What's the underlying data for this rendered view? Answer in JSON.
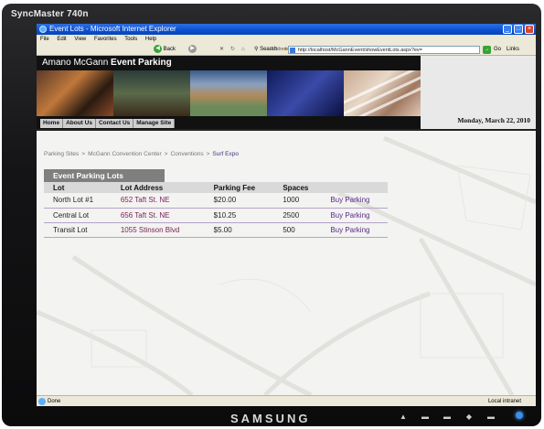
{
  "monitor": {
    "model": "SyncMaster 740n",
    "brand": "SAMSUNG"
  },
  "browser": {
    "window_title": "Event Lots - Microsoft Internet Explorer",
    "menu": [
      "File",
      "Edit",
      "View",
      "Favorites",
      "Tools",
      "Help"
    ],
    "toolbar": {
      "back_label": "Back",
      "search_label": "Search",
      "address_label": "Address",
      "address_value": "http://localhost/McGannEvent/showEventLots.aspx?ev=",
      "go_label": "Go",
      "links_label": "Links"
    },
    "status": {
      "left": "Done",
      "zone": "Local intranet"
    }
  },
  "site": {
    "title_prefix": "Amano McGann",
    "title_bold": "Event Parking",
    "nav": [
      "Home",
      "About Us",
      "Contact Us",
      "Manage Site"
    ],
    "date": "Monday, March 22, 2010"
  },
  "breadcrumb": [
    "Parking Sites",
    "McGann Convention Center",
    "Conventions",
    "Surf Expo"
  ],
  "section_title": "Event Parking Lots",
  "lots_table": {
    "columns": [
      "Lot",
      "Lot Address",
      "Parking Fee",
      "Spaces",
      ""
    ],
    "rows": [
      {
        "lot": "North Lot #1",
        "address": "652 Taft St. NE",
        "fee": "$20.00",
        "spaces": "1000",
        "action": "Buy Parking"
      },
      {
        "lot": "Central Lot",
        "address": "656 Taft St. NE",
        "fee": "$10.25",
        "spaces": "2500",
        "action": "Buy Parking"
      },
      {
        "lot": "Transit Lot",
        "address": "1055 Stinson Blvd",
        "fee": "$5.00",
        "spaces": "500",
        "action": "Buy Parking"
      }
    ]
  }
}
